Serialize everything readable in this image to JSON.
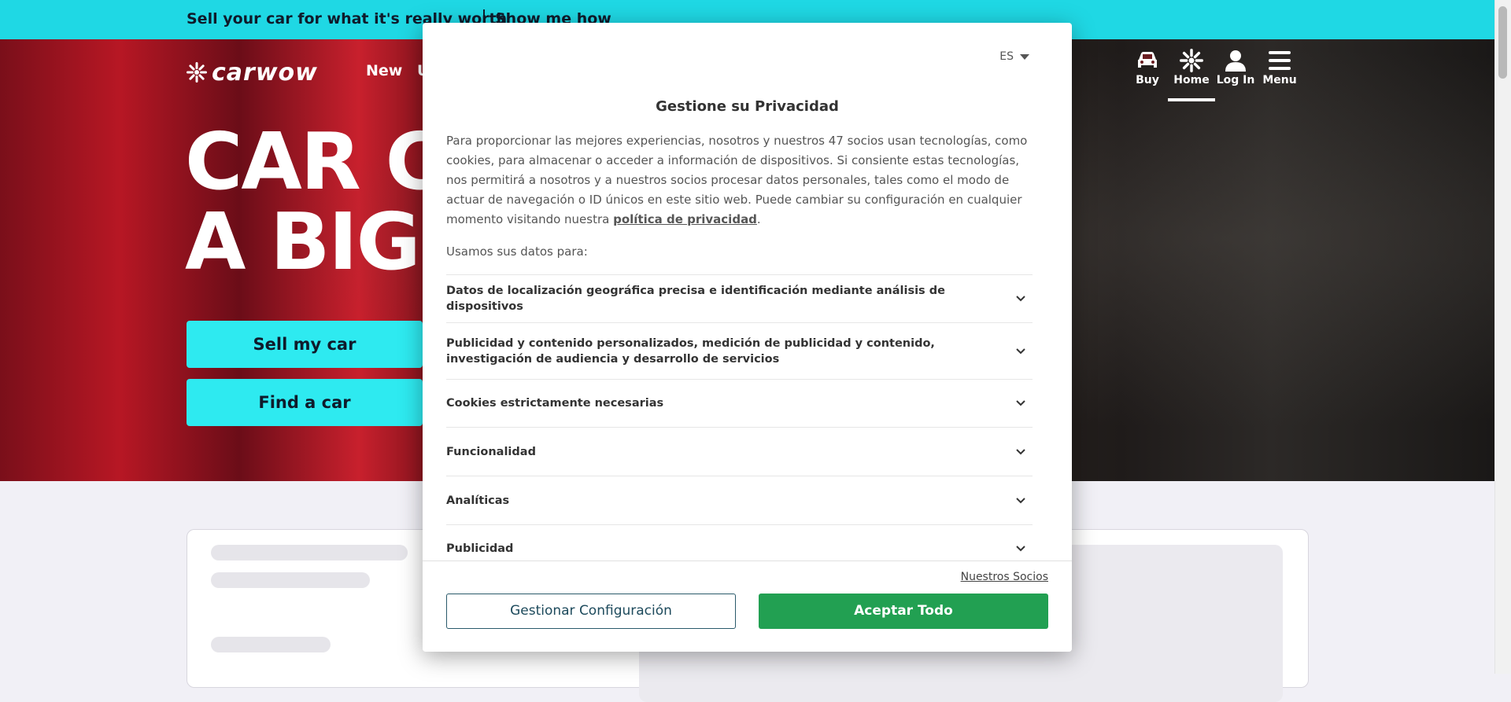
{
  "promo": {
    "text": "Sell your car for what it's really worth",
    "link": "Show me how"
  },
  "header": {
    "logo_text": "carwow",
    "nav": [
      "New",
      "U"
    ],
    "icons": [
      {
        "label": "Buy",
        "icon": "car-icon"
      },
      {
        "label": "Home",
        "icon": "carwow-mark-icon",
        "active": true
      },
      {
        "label": "Log In",
        "icon": "user-icon"
      },
      {
        "label": "Menu",
        "icon": "menu-icon"
      }
    ]
  },
  "hero": {
    "headline_line1": "CAR CI",
    "headline_line2": "A BIG I",
    "sell_button": "Sell my car",
    "find_button": "Find a car"
  },
  "consent": {
    "language": "ES",
    "title": "Gestione su Privacidad",
    "body_text": "Para proporcionar las mejores experiencias, nosotros y nuestros 47 socios usan tecnologías, como cookies, para almacenar o acceder a información de dispositivos. Si consiente estas tecnologías, nos permitirá a nosotros y a nuestros socios procesar datos personales, tales como el modo de actuar de navegación o ID únicos en este sitio web. Puede cambiar su configuración en cualquier momento visitando nuestra ",
    "privacy_link": "política de privacidad",
    "body_end": ".",
    "usamos": "Usamos sus datos para:",
    "purposes": [
      "Datos de localización geográfica precisa e identificación mediante análisis de dispositivos",
      "Publicidad y contenido personalizados, medición de publicidad y contenido, investigación de audiencia y desarrollo de servicios",
      "Cookies estrictamente necesarias",
      "Funcionalidad",
      "Analíticas",
      "Publicidad"
    ],
    "partners_link": "Nuestros Socios",
    "manage_button": "Gestionar Configuración",
    "accept_button": "Aceptar Todo"
  },
  "colors": {
    "promo_bg": "#1fd8e4",
    "hero_button": "#2eeaf0",
    "accept": "#22a052"
  }
}
